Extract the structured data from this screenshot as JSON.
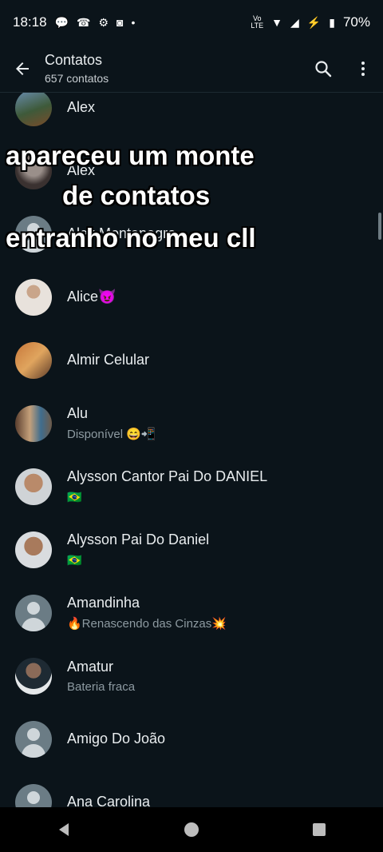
{
  "status_bar": {
    "time": "18:18",
    "battery": "70%",
    "network": "LTE"
  },
  "header": {
    "title": "Contatos",
    "subtitle": "657 contatos"
  },
  "overlay_caption": {
    "line1": "apareceu um monte",
    "line2": "de contatos",
    "line3": "entranho no meu cll"
  },
  "contacts": [
    {
      "name": "Alex",
      "status": ""
    },
    {
      "name": "Alex",
      "status": ""
    },
    {
      "name": "Alex Montenegro",
      "status": ""
    },
    {
      "name": "Alice😈",
      "status": ""
    },
    {
      "name": "Almir Celular",
      "status": ""
    },
    {
      "name": "Alu",
      "status": "Disponível 😄📲"
    },
    {
      "name": "Alysson Cantor Pai Do DANIEL",
      "status": "🇧🇷"
    },
    {
      "name": "Alysson Pai Do Daniel",
      "status": "🇧🇷"
    },
    {
      "name": "Amandinha",
      "status": "🔥Renascendo das Cinzas💥"
    },
    {
      "name": "Amatur",
      "status": "Bateria fraca"
    },
    {
      "name": "Amigo Do João",
      "status": ""
    },
    {
      "name": "Ana Carolina",
      "status": ""
    }
  ],
  "colors": {
    "background": "#0b141a",
    "text_primary": "#e9edef",
    "text_secondary": "#8d9aa1"
  }
}
